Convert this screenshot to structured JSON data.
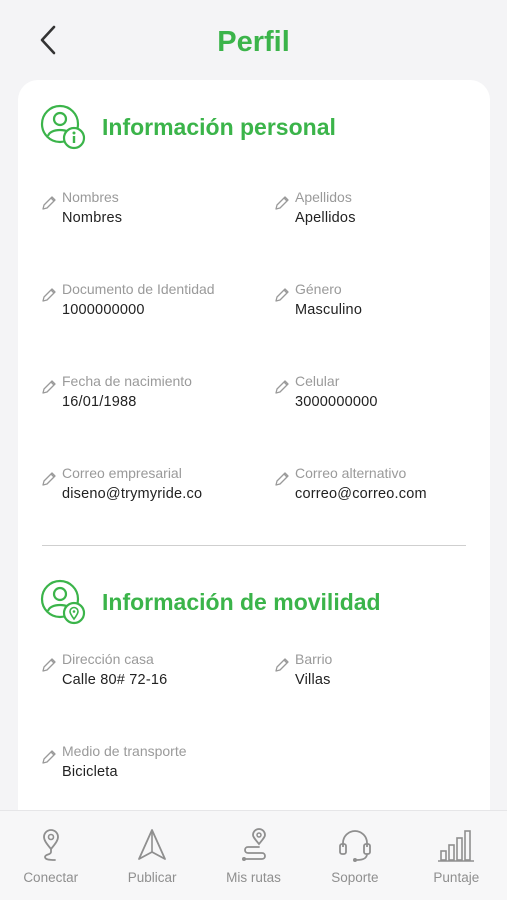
{
  "header": {
    "title": "Perfil",
    "back_icon": "chevron-left-icon"
  },
  "colors": {
    "accent": "#3bb44a",
    "label": "#9a9a9a",
    "value": "#222222",
    "nav": "#8f8f8f"
  },
  "personal": {
    "title": "Información personal",
    "icon": "user-info-icon",
    "fields": [
      {
        "label": "Nombres",
        "value": "Nombres"
      },
      {
        "label": "Apellidos",
        "value": "Apellidos"
      },
      {
        "label": "Documento de Identidad",
        "value": "1000000000"
      },
      {
        "label": "Género",
        "value": "Masculino"
      },
      {
        "label": "Fecha de nacimiento",
        "value": "16/01/1988"
      },
      {
        "label": "Celular",
        "value": "3000000000"
      },
      {
        "label": "Correo empresarial",
        "value": "diseno@trymyride.co"
      },
      {
        "label": "Correo alternativo",
        "value": "correo@correo.com"
      }
    ]
  },
  "mobility": {
    "title": "Información de movilidad",
    "icon": "user-location-icon",
    "fields": [
      {
        "label": "Dirección casa",
        "value": "Calle 80# 72-16"
      },
      {
        "label": "Barrio",
        "value": "Villas"
      },
      {
        "label": "Medio de transporte",
        "value": "Bicicleta"
      }
    ]
  },
  "nav": [
    {
      "label": "Conectar",
      "icon": "location-pin-route-icon"
    },
    {
      "label": "Publicar",
      "icon": "navigation-arrow-icon"
    },
    {
      "label": "Mis rutas",
      "icon": "route-pin-icon"
    },
    {
      "label": "Soporte",
      "icon": "headset-icon"
    },
    {
      "label": "Puntaje",
      "icon": "bar-chart-icon"
    }
  ]
}
